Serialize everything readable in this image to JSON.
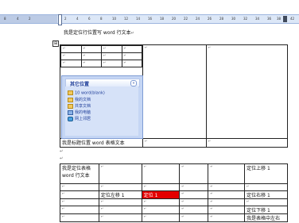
{
  "ruler": {
    "ticks": [
      "8",
      "4",
      "2",
      "2",
      "4",
      "6",
      "8",
      "10",
      "12",
      "14",
      "16",
      "18",
      "20",
      "22",
      "24",
      "26",
      "28",
      "30",
      "32",
      "34",
      "36",
      "38",
      "42"
    ]
  },
  "doc": {
    "line1": "我是定位行位置写 word 行文本",
    "table1_text": "我是标题位置 word 表格文本",
    "table2_cell_a1": "我是定位表格 word 行文本",
    "cell_top_right": "定位上移 1",
    "cell_mid1": "定位左移 1",
    "cell_mid_red": "定位 1",
    "cell_mid_right": "定位右移 1",
    "cell_bottom_right1": "定位下移 1",
    "cell_bottom_right2": "我是表格中左右"
  },
  "panel": {
    "title": "其它位置",
    "items": [
      "10 word(blank)",
      "我的文档",
      "共享文档",
      "我的电脑",
      "网上邻居"
    ]
  },
  "marks": {
    "pilcrow": "↵",
    "anchor": "⊞"
  }
}
